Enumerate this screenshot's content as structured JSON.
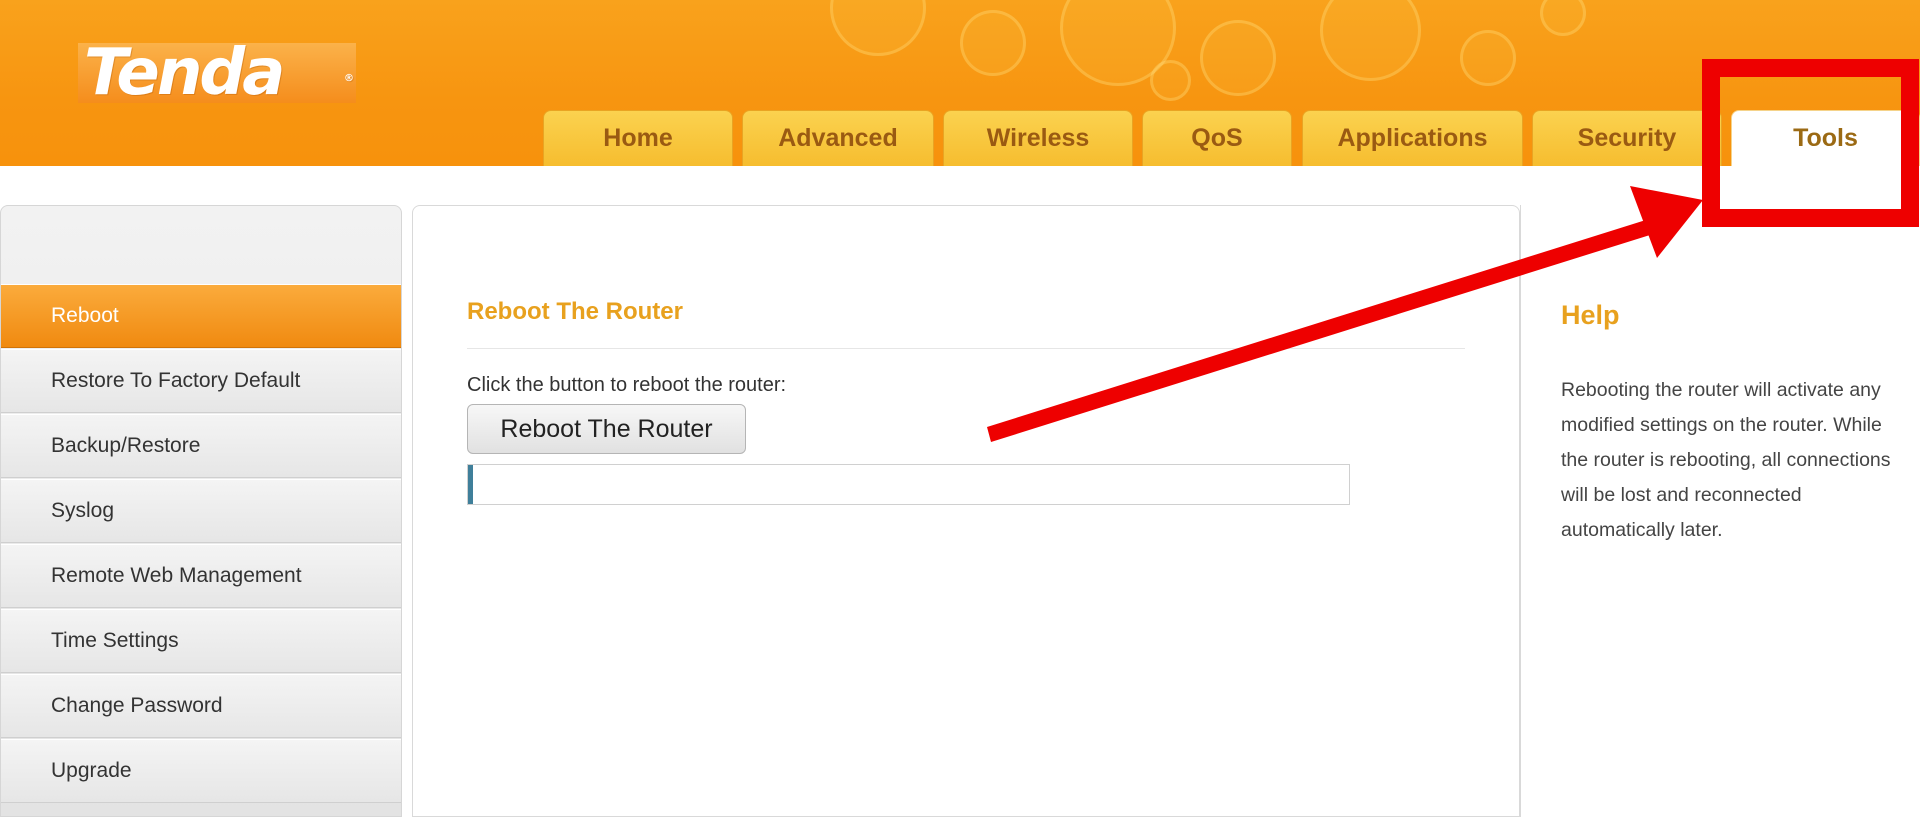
{
  "brand": {
    "logo_text": "Tenda",
    "registered": "®"
  },
  "nav": {
    "tabs": [
      {
        "label": "Home"
      },
      {
        "label": "Advanced"
      },
      {
        "label": "Wireless"
      },
      {
        "label": "QoS"
      },
      {
        "label": "Applications"
      },
      {
        "label": "Security"
      },
      {
        "label": "Tools"
      }
    ],
    "active_tab": "Tools"
  },
  "sidebar": {
    "items": [
      {
        "label": "Reboot"
      },
      {
        "label": "Restore To Factory Default"
      },
      {
        "label": "Backup/Restore"
      },
      {
        "label": "Syslog"
      },
      {
        "label": "Remote Web Management"
      },
      {
        "label": "Time Settings"
      },
      {
        "label": "Change Password"
      },
      {
        "label": "Upgrade"
      }
    ],
    "active_item": "Reboot"
  },
  "main": {
    "title": "Reboot The Router",
    "instruction": "Click the button to reboot the router:",
    "button_label": "Reboot The Router",
    "progress_fraction": 0.006
  },
  "help": {
    "title": "Help",
    "text": "Rebooting the router will activate any modified settings on the router. While the router is rebooting, all connections will be lost and reconnected automatically later."
  },
  "colors": {
    "header_orange": "#f7920c",
    "tab_yellow": "#f6bd2f",
    "title_accent": "#e8a11e",
    "active_sidebar": "#f08a10",
    "annotation_red": "#ee0000",
    "progress_fill": "#3f7f9a"
  }
}
